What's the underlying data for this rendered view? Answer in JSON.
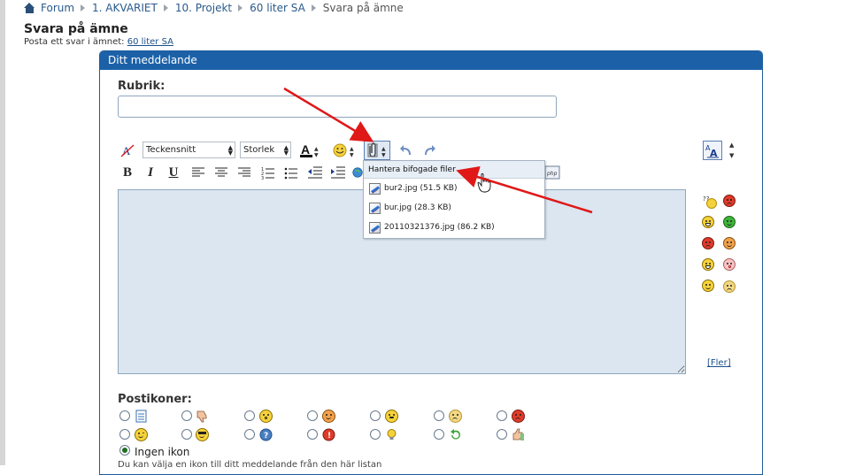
{
  "breadcrumb": {
    "items": [
      "Forum",
      "1. AKVARIET",
      "10. Projekt",
      "60 liter SA"
    ],
    "current": "Svara på ämne"
  },
  "page": {
    "title": "Svara på ämne",
    "subtitle_prefix": "Posta ett svar i ämnet:",
    "subtitle_link": "60 liter SA"
  },
  "panel": {
    "header": "Ditt meddelande",
    "subject_label": "Rubrik:",
    "subject_value": ""
  },
  "toolbar": {
    "font_select": "Teckensnitt",
    "size_select": "Storlek",
    "bold": "B",
    "italic": "I",
    "underline": "U"
  },
  "attachments": {
    "header": "Hantera bifogade filer",
    "files": [
      "bur2.jpg (51.5 KB)",
      "bur.jpg (28.3 KB)",
      "20110321376.jpg (86.2 KB)"
    ]
  },
  "smileys": {
    "more_link": "[Fler]",
    "icons": [
      "confused-icon",
      "mad-icon",
      "grin-icon",
      "green-smile-icon",
      "angry-icon",
      "wink-icon",
      "laugh-icon",
      "embarrassed-icon",
      "smile-icon",
      "sad-icon"
    ]
  },
  "post_icons": {
    "label": "Postikoner:",
    "no_icon_label": "Ingen ikon",
    "selected": "Ingen ikon",
    "cut_text": "Du kan välja en ikon till ditt meddelande från den här listan"
  },
  "colors": {
    "panel_header": "#1c61a8",
    "link": "#2a5a8c",
    "editor_bg": "#dbe6f1",
    "annotation_arrow": "#e01818"
  }
}
